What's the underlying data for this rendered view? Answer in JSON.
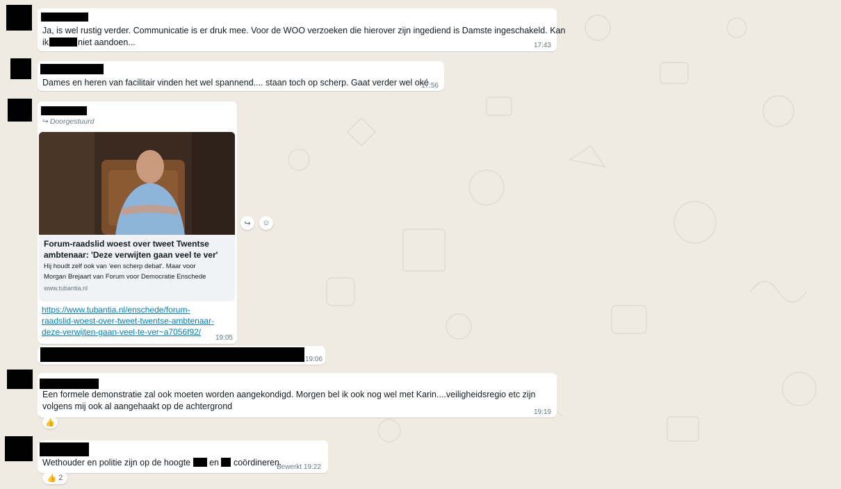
{
  "messages": [
    {
      "text": "Ja, is wel rustig verder. Communicatie is er druk mee. Voor de WOO verzoeken die hierover zijn ingediend is Damste ingeschakeld. Kan",
      "text_line2_a": "ik",
      "text_line2_b": "niet aandoen...",
      "time": "17:43"
    },
    {
      "text": "Dames en heren van facilitair vinden het wel spannend.... staan toch op scherp. Gaat verder wel oké",
      "time": "17:56"
    },
    {
      "forwarded_label": "Doorgestuurd",
      "preview_title_1": "Forum-raadslid woest over tweet Twentse",
      "preview_title_2": "ambtenaar: 'Deze verwijten gaan veel te ver'",
      "preview_desc_1": "Hij houdt zelf ook van 'een scherp debat'. Maar voor",
      "preview_desc_2": "Morgan Brejaart van Forum voor Democratie Enschede",
      "preview_domain": "www.tubantia.nl",
      "link_1": "https://www.tubantia.nl/enschede/forum-",
      "link_2": "raadslid-woest-over-tweet-twentse-ambtenaar-",
      "link_3": "deze-verwijten-gaan-veel-te-ver~a7056f92/",
      "time": "19:05"
    },
    {
      "time": "19:06"
    },
    {
      "text_1": "Een formele demonstratie zal ook moeten worden aangekondigd. Morgen bel ik ook nog wel met Karin....veiligheidsregio etc zijn",
      "text_2": "volgens mij ook al aangehaakt op de achtergrond",
      "time": "19:19",
      "reaction_emoji": "👍"
    },
    {
      "text_a": "Wethouder en politie zijn op de hoogte",
      "text_b": "en",
      "text_c": "coördineren.",
      "edited_label": "Bewerkt",
      "time": "19:22",
      "reaction_emoji": "👍",
      "reaction_count": "2"
    }
  ],
  "icons": {
    "forward": "forward-icon",
    "emoji": "emoji-icon",
    "thumbs_up": "thumbs-up-icon"
  },
  "colors": {
    "wallpaper": "#efeae2",
    "bubble": "#ffffff",
    "link": "#027eb5",
    "meta": "#667781"
  }
}
